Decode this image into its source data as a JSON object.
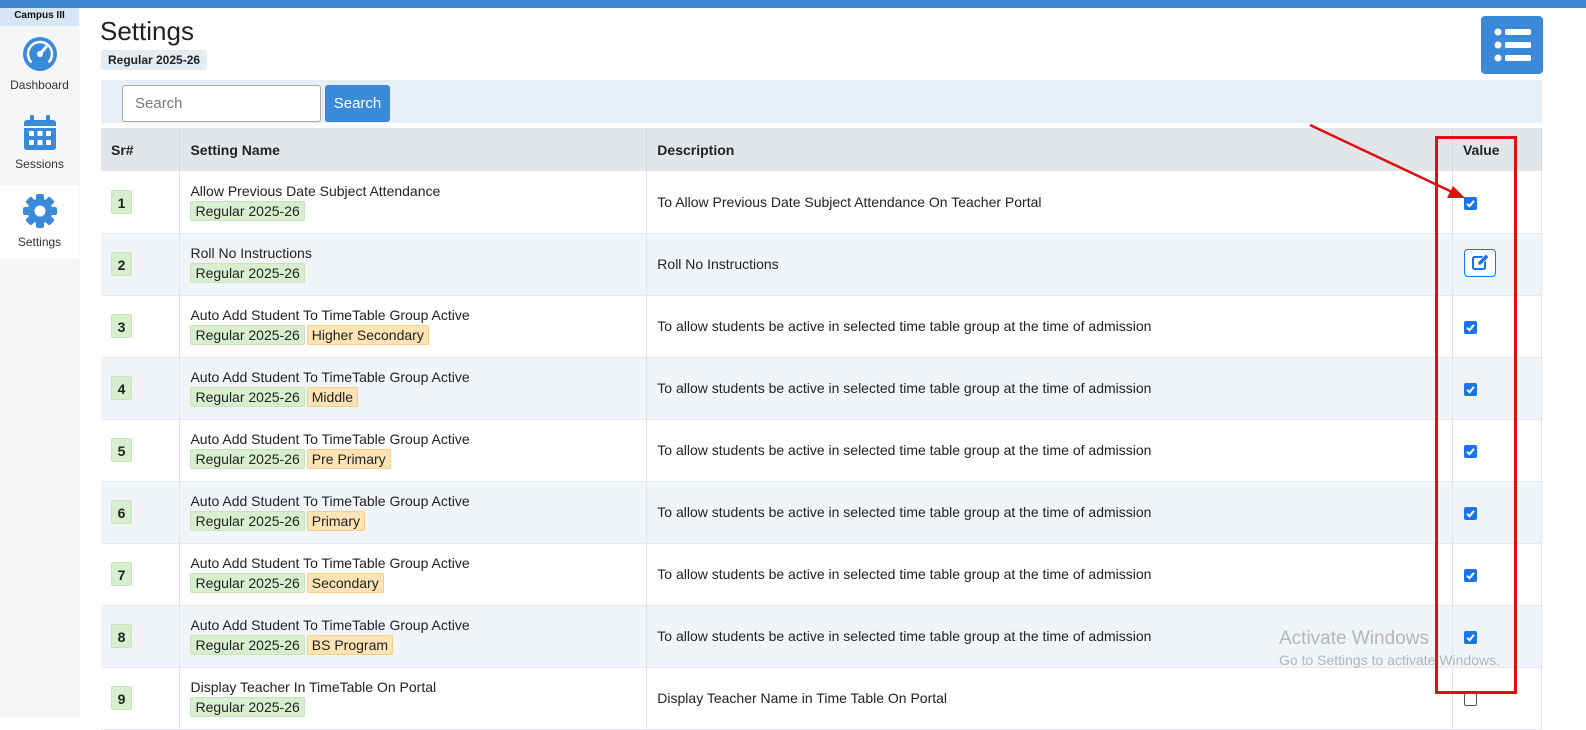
{
  "sidebar": {
    "campus": "Campus III",
    "items": [
      {
        "label": "Dashboard"
      },
      {
        "label": "Sessions"
      },
      {
        "label": "Settings"
      }
    ]
  },
  "header": {
    "title": "Settings",
    "session_badge": "Regular 2025-26"
  },
  "search": {
    "placeholder": "Search",
    "button_label": "Search"
  },
  "table": {
    "columns": [
      "Sr#",
      "Setting Name",
      "Description",
      "Value"
    ],
    "rows": [
      {
        "sr": "1",
        "name": "Allow Previous Date Subject Attendance",
        "session": "Regular 2025-26",
        "level": "",
        "description": "To Allow Previous Date Subject Attendance On Teacher Portal",
        "value": "checked"
      },
      {
        "sr": "2",
        "name": "Roll No Instructions",
        "session": "Regular 2025-26",
        "level": "",
        "description": "Roll No Instructions",
        "value": "edit"
      },
      {
        "sr": "3",
        "name": "Auto Add Student To TimeTable Group Active",
        "session": "Regular 2025-26",
        "level": "Higher Secondary",
        "description": "To allow students be active in selected time table group at the time of admission",
        "value": "checked"
      },
      {
        "sr": "4",
        "name": "Auto Add Student To TimeTable Group Active",
        "session": "Regular 2025-26",
        "level": "Middle",
        "description": "To allow students be active in selected time table group at the time of admission",
        "value": "checked"
      },
      {
        "sr": "5",
        "name": "Auto Add Student To TimeTable Group Active",
        "session": "Regular 2025-26",
        "level": "Pre Primary",
        "description": "To allow students be active in selected time table group at the time of admission",
        "value": "checked"
      },
      {
        "sr": "6",
        "name": "Auto Add Student To TimeTable Group Active",
        "session": "Regular 2025-26",
        "level": "Primary",
        "description": "To allow students be active in selected time table group at the time of admission",
        "value": "checked"
      },
      {
        "sr": "7",
        "name": "Auto Add Student To TimeTable Group Active",
        "session": "Regular 2025-26",
        "level": "Secondary",
        "description": "To allow students be active in selected time table group at the time of admission",
        "value": "checked"
      },
      {
        "sr": "8",
        "name": "Auto Add Student To TimeTable Group Active",
        "session": "Regular 2025-26",
        "level": "BS Program",
        "description": "To allow students be active in selected time table group at the time of admission",
        "value": "checked"
      },
      {
        "sr": "9",
        "name": "Display Teacher In TimeTable On Portal",
        "session": "Regular 2025-26",
        "level": "",
        "description": "Display Teacher Name in Time Table On Portal",
        "value": "unchecked"
      }
    ]
  },
  "watermark": {
    "line1": "Activate Windows",
    "line2": "Go to Settings to activate Windows."
  },
  "colors": {
    "accent": "#3b8ad9",
    "annotation": "#e01010"
  }
}
